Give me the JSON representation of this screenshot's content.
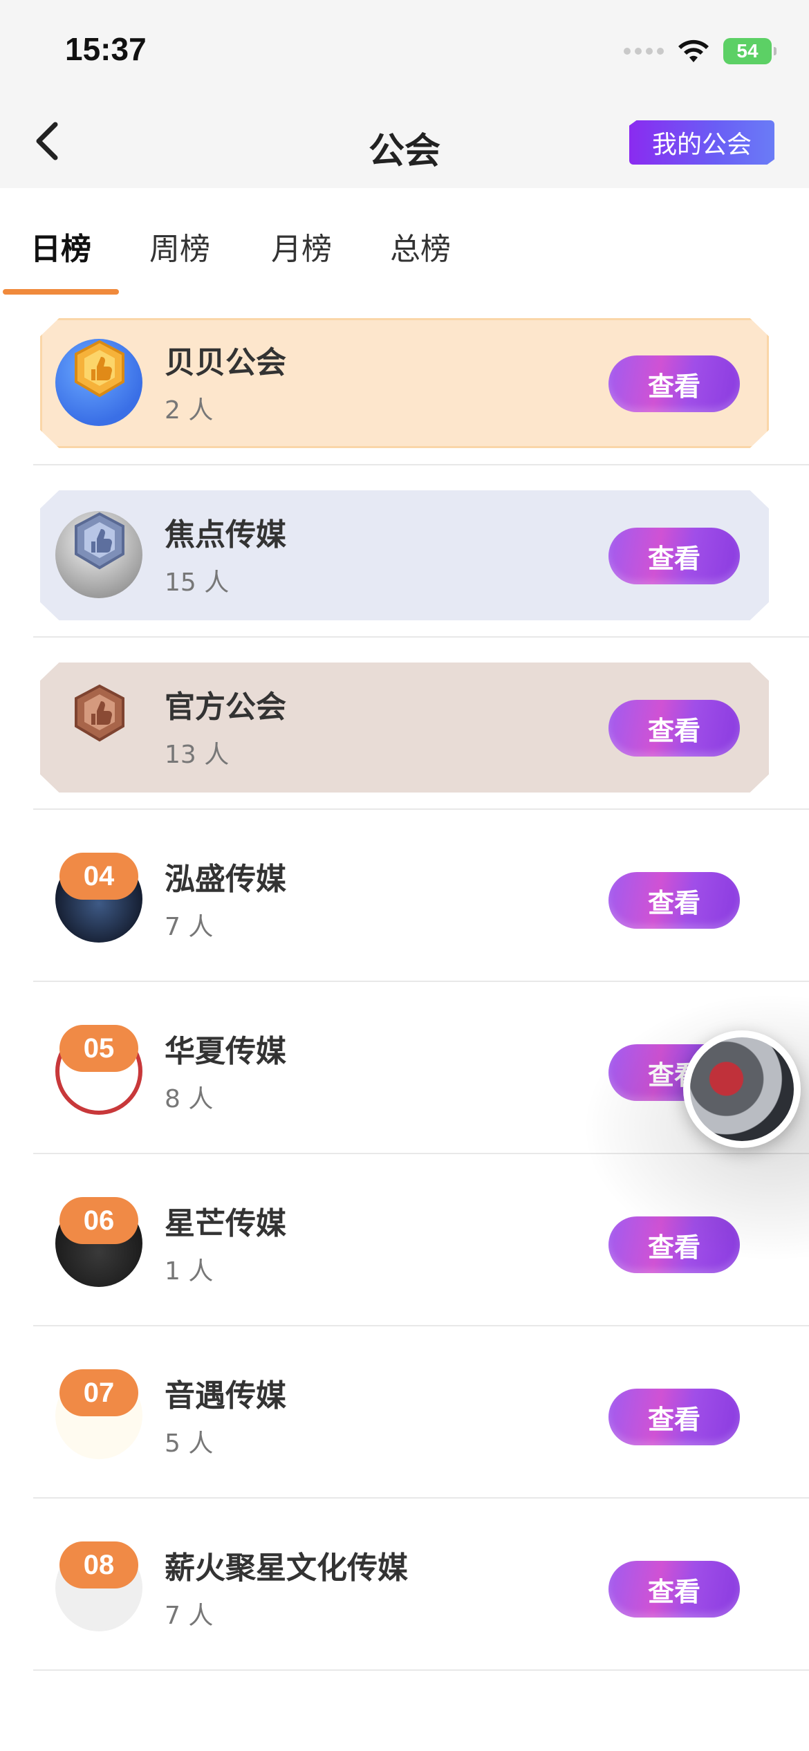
{
  "status_bar": {
    "time": "15:37",
    "battery": "54"
  },
  "header": {
    "title": "公会",
    "my_guild_label": "我的公会"
  },
  "tabs": [
    {
      "label": "日榜",
      "active": true
    },
    {
      "label": "周榜",
      "active": false
    },
    {
      "label": "月榜",
      "active": false
    },
    {
      "label": "总榜",
      "active": false
    }
  ],
  "guilds": [
    {
      "rank": "01",
      "name": "贝贝公会",
      "members": "2 人",
      "view_label": "查看",
      "tier": "gold"
    },
    {
      "rank": "02",
      "name": "焦点传媒",
      "members": "15 人",
      "view_label": "查看",
      "tier": "silver"
    },
    {
      "rank": "03",
      "name": "官方公会",
      "members": "13 人",
      "view_label": "查看",
      "tier": "bronze"
    },
    {
      "rank": "04",
      "name": "泓盛传媒",
      "members": "7 人",
      "view_label": "查看",
      "tier": "none"
    },
    {
      "rank": "05",
      "name": "华夏传媒",
      "members": "8 人",
      "view_label": "查看",
      "tier": "none"
    },
    {
      "rank": "06",
      "name": "星芒传媒",
      "members": "1 人",
      "view_label": "查看",
      "tier": "none"
    },
    {
      "rank": "07",
      "name": "音遇传媒",
      "members": "5 人",
      "view_label": "查看",
      "tier": "none"
    },
    {
      "rank": "08",
      "name": "薪火聚星文化传媒",
      "members": "7 人",
      "view_label": "查看",
      "tier": "none"
    }
  ],
  "colors": {
    "accent": "#f08a3c",
    "view_button": "#a04ee8",
    "my_guild_button": "#7a45f2"
  }
}
